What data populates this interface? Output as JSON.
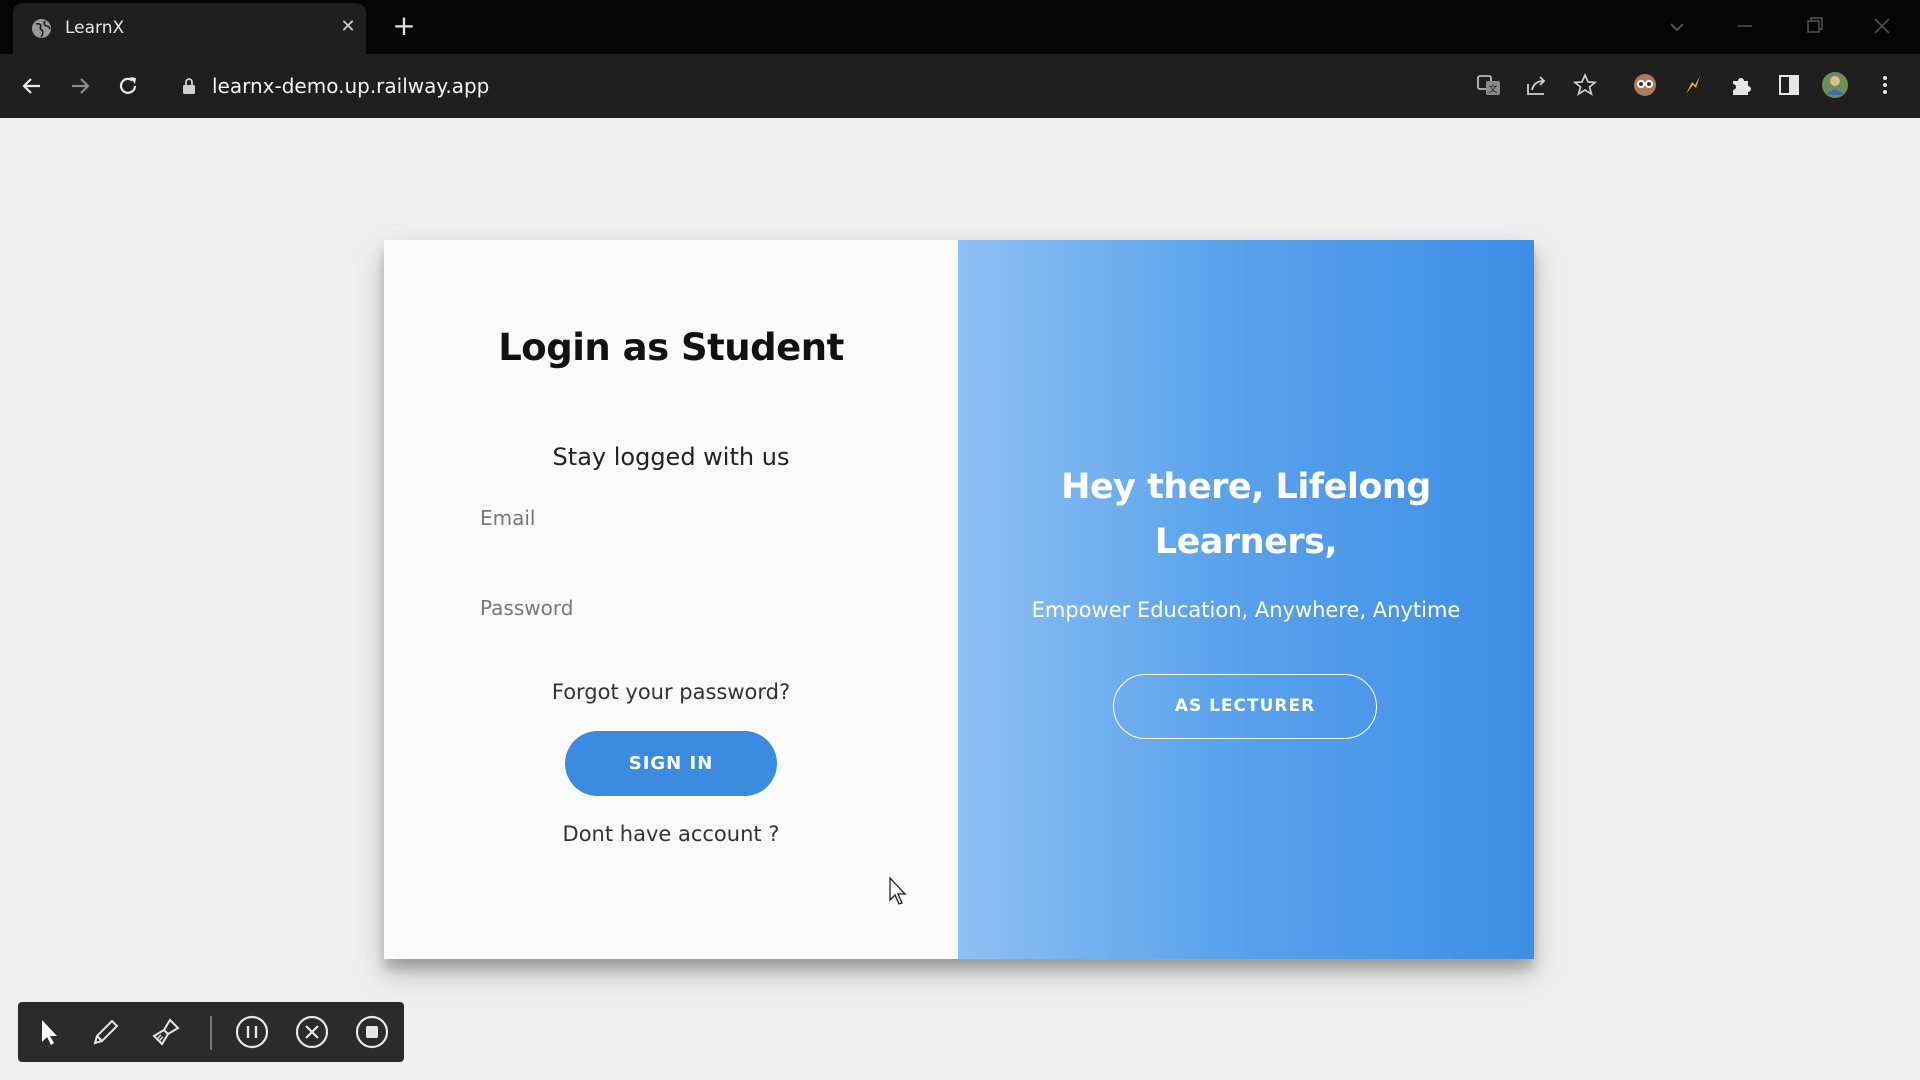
{
  "browser": {
    "tab_title": "LearnX",
    "url": "learnx-demo.up.railway.app",
    "icons": {
      "tab_favicon": "globe-icon",
      "tab_close": "close-icon",
      "new_tab": "plus-icon",
      "back": "arrow-left-icon",
      "forward": "arrow-right-icon",
      "reload": "reload-icon",
      "lock": "lock-icon",
      "translate": "translate-icon",
      "share": "share-icon",
      "bookmark": "star-icon",
      "extension_1": "eyes-extension-icon",
      "extension_2": "bolt-extension-icon",
      "extensions": "puzzle-icon",
      "side_panel": "side-panel-icon",
      "profile": "profile-avatar-icon",
      "menu": "kebab-menu-icon"
    },
    "tab_close_glyph": "✕",
    "new_tab_glyph": "+"
  },
  "login": {
    "title": "Login as Student",
    "subtitle": "Stay logged with us",
    "email_placeholder": "Email",
    "email_value": "",
    "password_placeholder": "Password",
    "password_value": "",
    "forgot_label": "Forgot your password?",
    "signin_label": "SIGN IN",
    "no_account_label": "Dont have account ?"
  },
  "overlay": {
    "title_line1": "Hey there, Lifelong",
    "title_line2": "Learners,",
    "tagline": "Empower Education, Anywhere, Anytime",
    "lecturer_label": "AS LECTURER"
  },
  "recorder": {
    "tools": [
      "pointer-icon",
      "pencil-icon",
      "brush-icon",
      "pause-icon",
      "cancel-icon",
      "stop-icon"
    ]
  },
  "colors": {
    "accent": "#3b8be1",
    "gradient_start": "#8ec0f2",
    "gradient_end": "#3d8ee6",
    "page_background": "#efefef"
  }
}
